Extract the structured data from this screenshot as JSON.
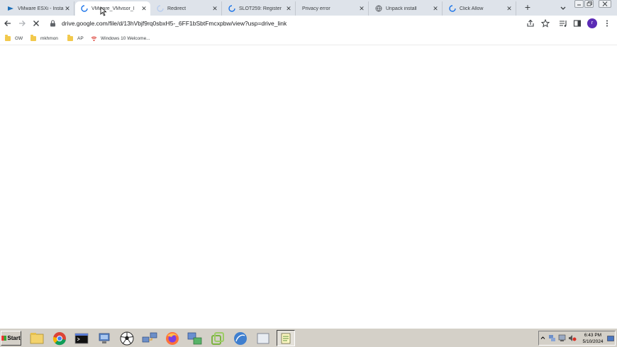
{
  "tabs": [
    {
      "title": "VMware ESXi - Instal",
      "favicon": "vmware-icon",
      "active": false
    },
    {
      "title": "VMware_VMvisor_I",
      "favicon": "loading-spinner-icon",
      "active": true
    },
    {
      "title": "Redirect",
      "favicon": "loading-spinner-icon",
      "active": false
    },
    {
      "title": "SLOT259: Register",
      "favicon": "loading-spinner-icon",
      "active": false
    },
    {
      "title": "Privacy error",
      "favicon": "none",
      "active": false
    },
    {
      "title": "Unpack install",
      "favicon": "globe-icon",
      "active": false
    },
    {
      "title": "Click Allow",
      "favicon": "loading-spinner-icon",
      "active": false
    }
  ],
  "toolbar": {
    "url": "drive.google.com/file/d/13hVbjf9rq0sbxH5-_6FF1bSbtFmcxpbw/view?usp=drive_link",
    "profile_initial": "r"
  },
  "bookmarks": [
    {
      "label": "GW",
      "icon": "folder-icon"
    },
    {
      "label": "mkhmon",
      "icon": "folder-icon"
    },
    {
      "label": "AP",
      "icon": "folder-icon"
    },
    {
      "label": "Windows 10 Welcome...",
      "icon": "wifi-icon"
    }
  ],
  "taskbar": {
    "start_label": "Start",
    "apps": [
      "file-explorer-icon",
      "chrome-icon",
      "command-prompt-icon",
      "network-icon",
      "soccer-ball-icon",
      "network-computers-icon",
      "firefox-icon",
      "remote-desktop-icon",
      "vmware-workstation-icon",
      "vsphere-client-icon",
      "blank-window-icon",
      "notepad-icon"
    ],
    "clock_time": "6:43 PM",
    "clock_date": "5/10/2024"
  },
  "colors": {
    "tabstrip_bg": "#dee3ea",
    "profile_bg": "#5b2bb5",
    "chrome_blue": "#1a73e8",
    "taskbar_bg": "#d4d0c8"
  }
}
